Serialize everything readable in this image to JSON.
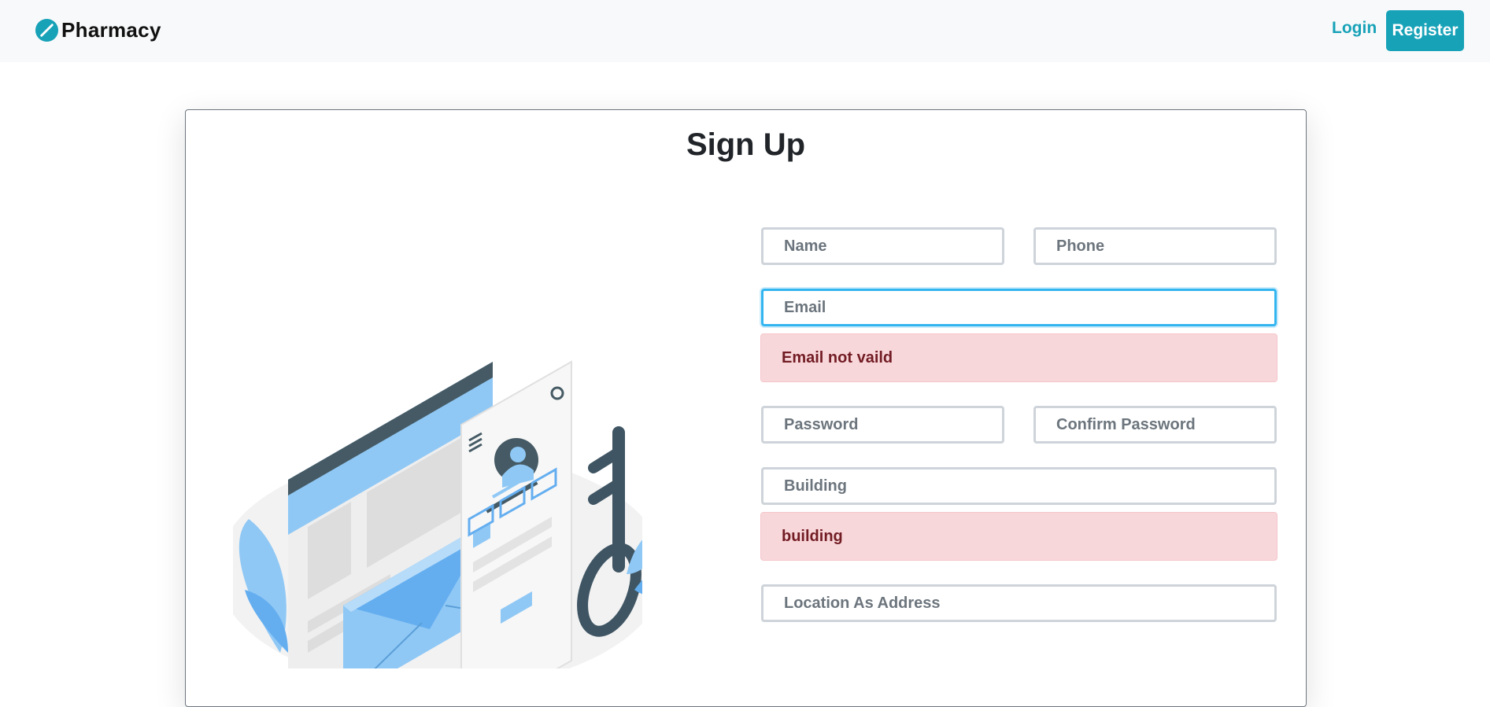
{
  "navbar": {
    "brand": "Pharmacy",
    "login_label": "Login",
    "register_label": "Register"
  },
  "page": {
    "title": "Sign Up"
  },
  "form": {
    "name_placeholder": "Name",
    "phone_placeholder": "Phone",
    "email_placeholder": "Email",
    "email_error": "Email not vaild",
    "password_placeholder": "Password",
    "confirm_password_placeholder": "Confirm Password",
    "building_placeholder": "Building",
    "building_error": "building",
    "location_placeholder": "Location As Address"
  },
  "colors": {
    "accent": "#17a2b8",
    "navbar_bg": "#f8f9fa",
    "error_bg": "#f8d7da",
    "error_text": "#721c24",
    "focus_border": "#33b5f0"
  },
  "icons": {
    "brand": "pharmacy-logo-icon",
    "illustration": "signup-illustration"
  }
}
